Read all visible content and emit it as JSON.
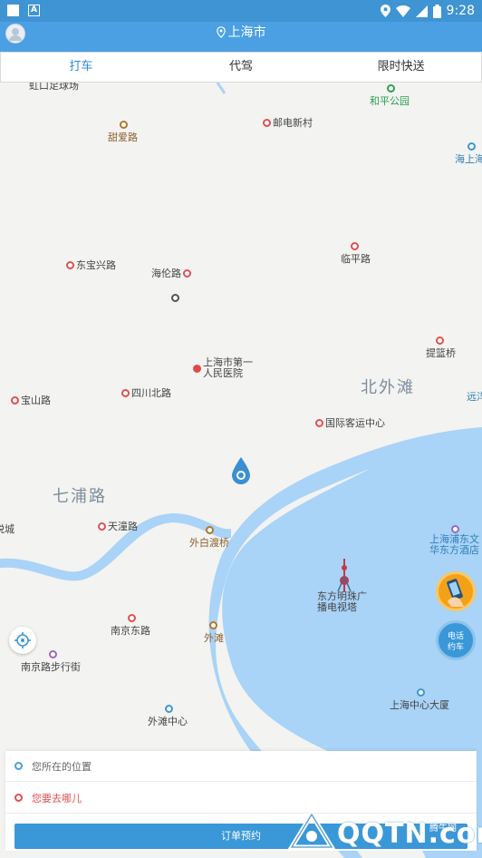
{
  "status_bar": {
    "time": "9:28"
  },
  "header": {
    "city": "上海市"
  },
  "tabs": [
    {
      "label": "打车",
      "active": true
    },
    {
      "label": "代驾",
      "active": false
    },
    {
      "label": "限时快送",
      "active": false
    }
  ],
  "map": {
    "areas": [
      "北外滩",
      "七浦路"
    ],
    "pois": {
      "hongkou_stadium": "虹口足球场",
      "heping_park": "和平公园",
      "tianai_rd": "甜爱路",
      "youdian_village": "邮电新村",
      "shanghai_right": "海上海",
      "dongbaoxing_rd": "东宝兴路",
      "hailun_rd": "海伦路",
      "linping_rd": "临平路",
      "first_hospital": "上海市第一人民医院",
      "baoshan_rd": "宝山路",
      "sichuan_north_rd": "四川北路",
      "tilanqiao": "提篮桥",
      "yuanj": "远洋",
      "intl_cruise": "国际客运中心",
      "tiantong_rd": "天潼路",
      "waibaidu_bridge": "外白渡桥",
      "yuecheng": "悦城",
      "pudong_hotel": "上海浦东文华东方酒店",
      "oriental_pearl": "东方明珠广播电视塔",
      "nanjing_east_rd": "南京东路",
      "the_bund": "外滩",
      "nanjing_walking_street": "南京路步行街",
      "bund_center": "外滩中心",
      "shanghai_center": "上海中心大厦"
    }
  },
  "buttons": {
    "call_taxi": "电话约车",
    "order": "订单预约"
  },
  "form": {
    "from_placeholder": "您所在的位置",
    "to_placeholder": "您要去哪儿"
  },
  "watermark": {
    "brand": "QQTN.com",
    "sub": "腾牛网"
  },
  "colors": {
    "primary": "#3a98d8",
    "water": "#a9d3f7",
    "land": "#f3f3f1"
  }
}
